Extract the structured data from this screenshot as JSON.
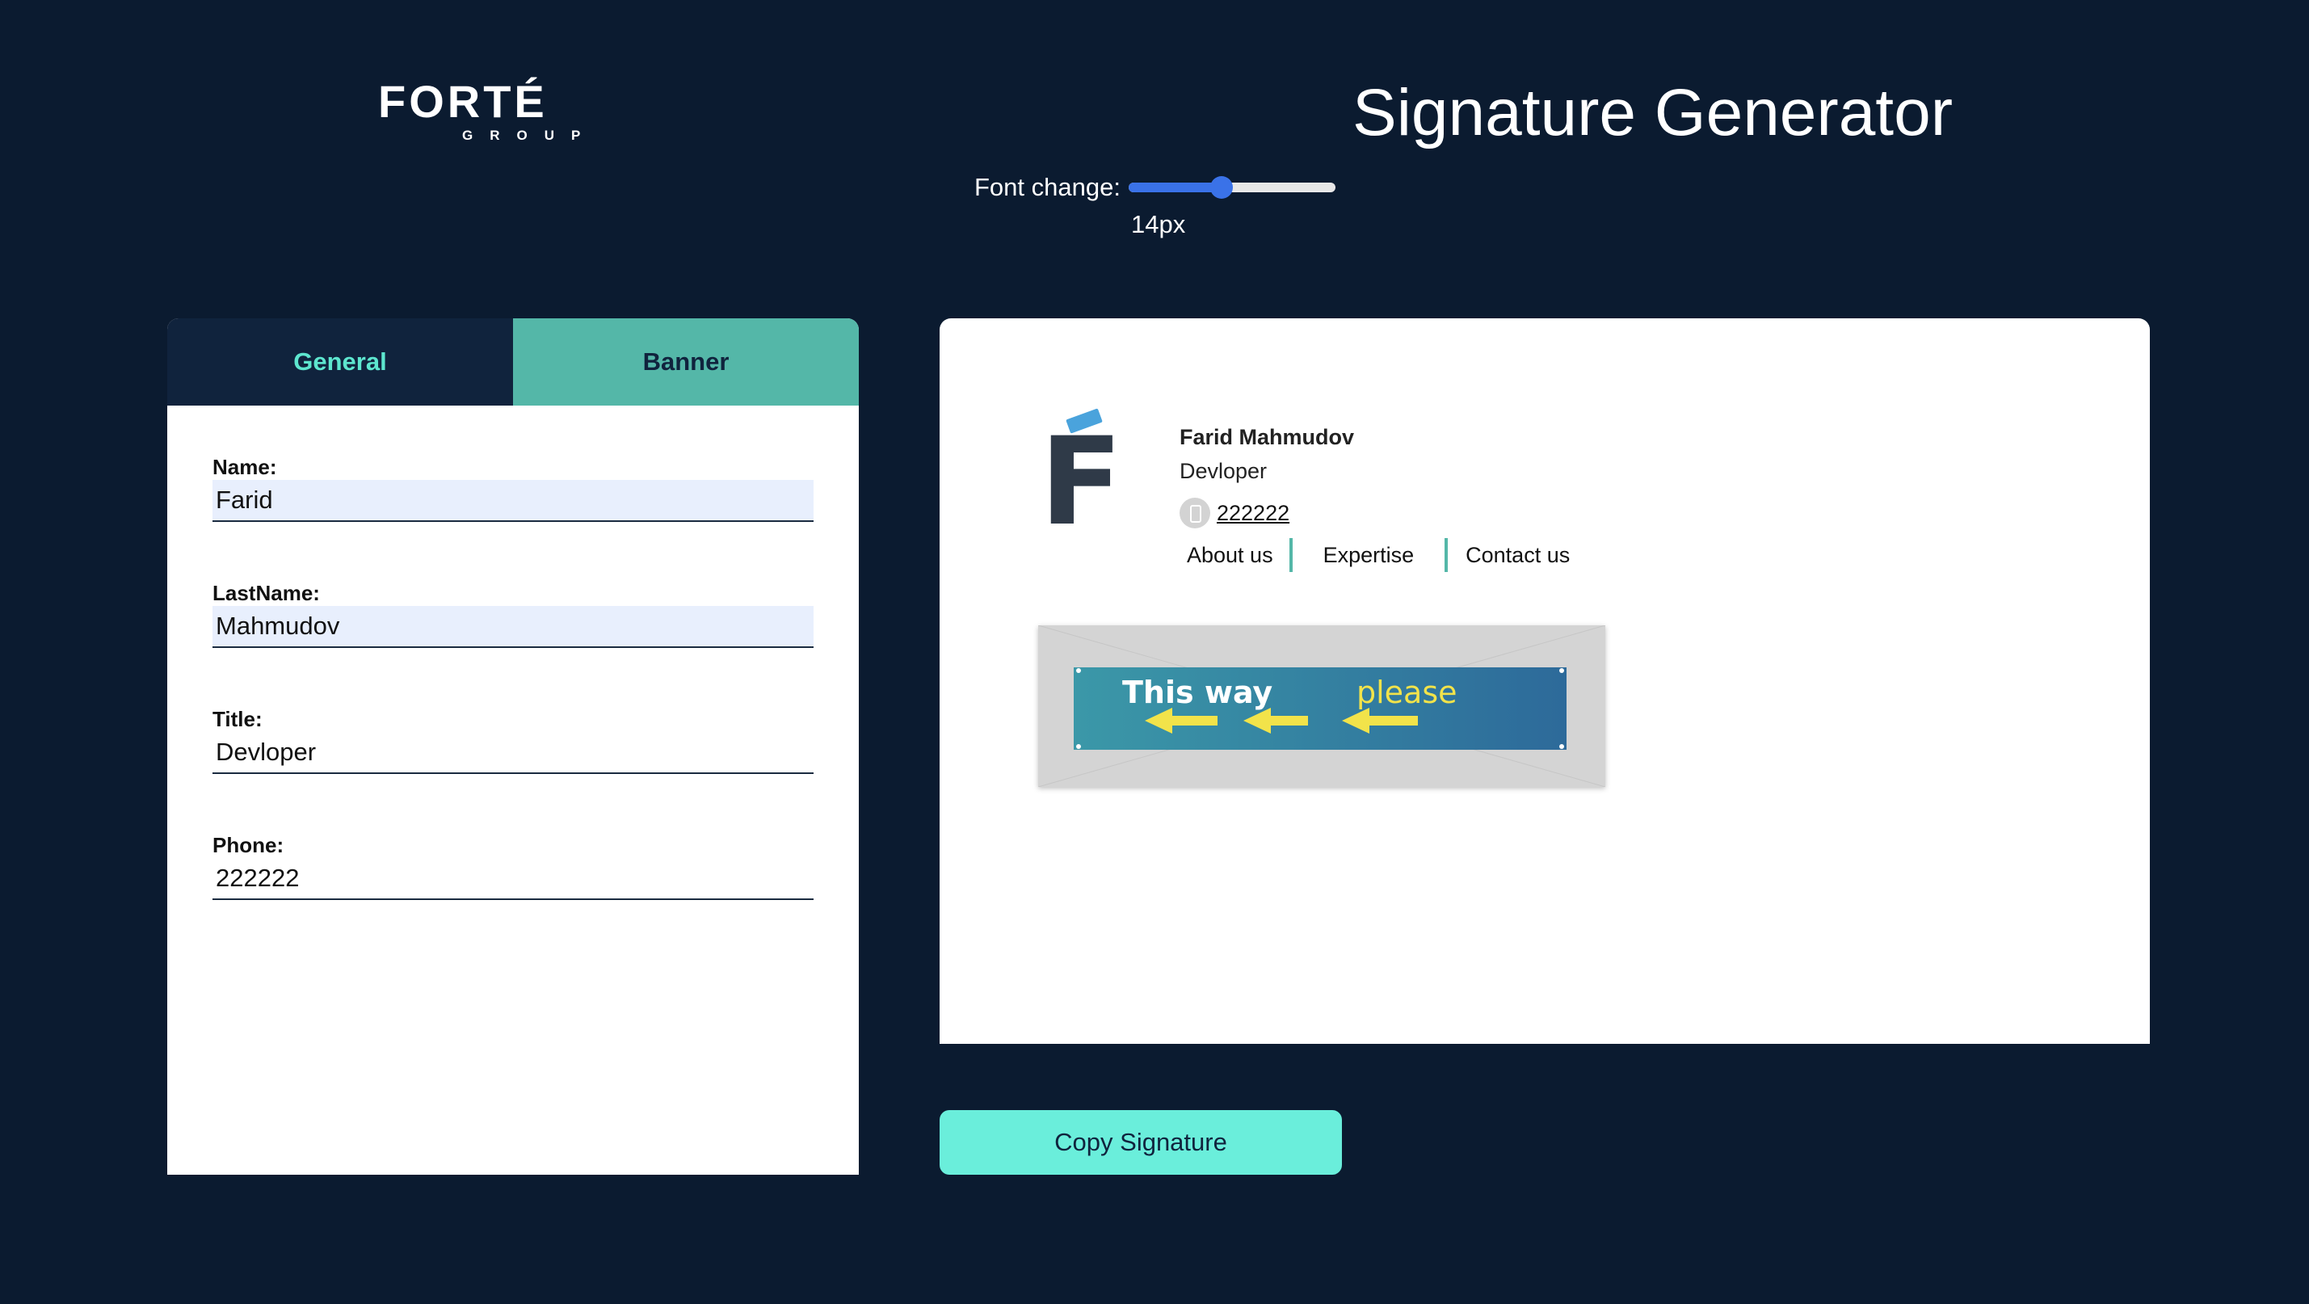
{
  "logo": {
    "brand": "FORTÉ",
    "subtitle": "GROUP"
  },
  "header": {
    "title": "Signature Generator"
  },
  "font_control": {
    "label": "Font change:",
    "value": "14px",
    "level": 0.45
  },
  "tabs": [
    {
      "label": "General",
      "active": true
    },
    {
      "label": "Banner",
      "active": false
    }
  ],
  "form": {
    "name": {
      "label": "Name:",
      "value": "Farid"
    },
    "lastname": {
      "label": "LastName:",
      "value": "Mahmudov"
    },
    "title": {
      "label": "Title:",
      "value": "Devloper"
    },
    "phone": {
      "label": "Phone:",
      "value": "222222"
    }
  },
  "preview": {
    "full_name": "Farid Mahmudov",
    "title": "Devloper",
    "phone": "222222",
    "links": [
      "About us",
      "Expertise",
      "Contact us"
    ],
    "banner": {
      "text_bold": "This way",
      "text_light": "please"
    }
  },
  "actions": {
    "copy_label": "Copy Signature"
  },
  "colors": {
    "background": "#0b1b30",
    "accent_teal": "#54b7a8",
    "button_mint": "#6aeedb",
    "slider_blue": "#3a72e8"
  }
}
